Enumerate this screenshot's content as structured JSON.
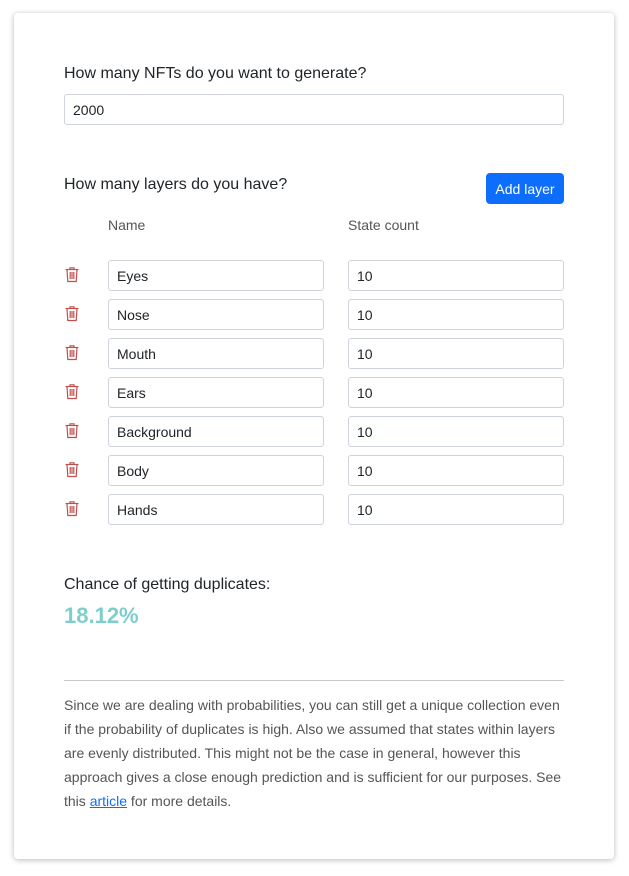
{
  "nft_question": "How many NFTs do you want to generate?",
  "nft_count": "2000",
  "layers_question": "How many layers do you have?",
  "add_layer_label": "Add layer",
  "columns": {
    "name": "Name",
    "state_count": "State count"
  },
  "layers": [
    {
      "name": "Eyes",
      "count": "10"
    },
    {
      "name": "Nose",
      "count": "10"
    },
    {
      "name": "Mouth",
      "count": "10"
    },
    {
      "name": "Ears",
      "count": "10"
    },
    {
      "name": "Background",
      "count": "10"
    },
    {
      "name": "Body",
      "count": "10"
    },
    {
      "name": "Hands",
      "count": "10"
    }
  ],
  "chance_label": "Chance of getting duplicates:",
  "chance_value": "18.12%",
  "note": {
    "text_before": "Since we are dealing with probabilities, you can still get a unique collection even if the probability of duplicates is high. Also we assumed that states within layers are evenly distributed. This might not be the case in general, however this approach gives a close enough prediction and is sufficient for our purposes. See this ",
    "link": "article",
    "text_after": " for more details."
  },
  "colors": {
    "accent": "#0d6efd",
    "trash": "#c0504d",
    "result": "#7ecfcb"
  },
  "icons": {
    "delete": "trash-icon"
  }
}
